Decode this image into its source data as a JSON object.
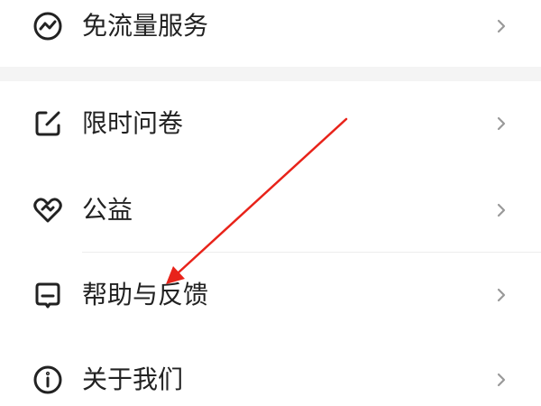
{
  "menu": {
    "items": [
      {
        "label": "免流量服务",
        "icon": "traffic-trend-icon"
      },
      {
        "label": "限时问卷",
        "icon": "edit-square-icon"
      },
      {
        "label": "公益",
        "icon": "heart-hands-icon"
      },
      {
        "label": "帮助与反馈",
        "icon": "message-box-icon"
      },
      {
        "label": "关于我们",
        "icon": "info-circle-icon"
      }
    ],
    "chevron_icon": "chevron-right-icon"
  },
  "annotation": {
    "arrow_color": "#e8231a",
    "target": "帮助与反馈"
  },
  "colors": {
    "text": "#222222",
    "icon": "#222222",
    "chevron": "#999999",
    "section_gap": "#f4f4f4",
    "divider": "#ededed"
  }
}
